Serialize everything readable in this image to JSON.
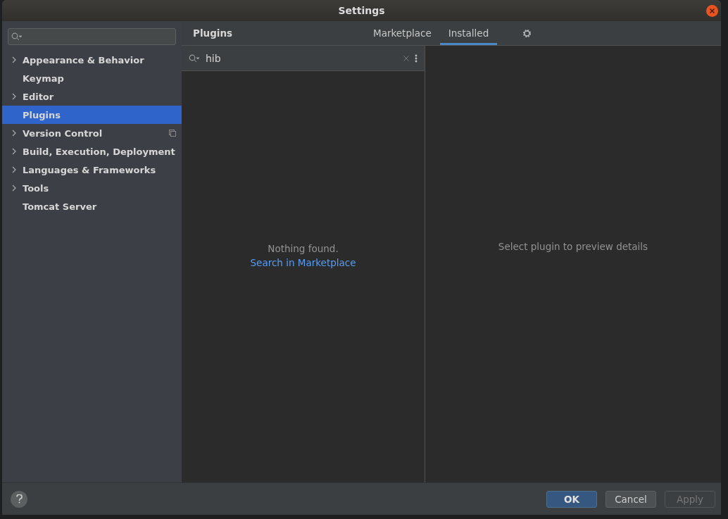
{
  "window": {
    "title": "Settings"
  },
  "sidebar": {
    "items": [
      {
        "label": "Appearance & Behavior",
        "expandable": true,
        "selected": false,
        "badge": false
      },
      {
        "label": "Keymap",
        "expandable": false,
        "selected": false,
        "badge": false
      },
      {
        "label": "Editor",
        "expandable": true,
        "selected": false,
        "badge": false
      },
      {
        "label": "Plugins",
        "expandable": false,
        "selected": true,
        "badge": false
      },
      {
        "label": "Version Control",
        "expandable": true,
        "selected": false,
        "badge": true
      },
      {
        "label": "Build, Execution, Deployment",
        "expandable": true,
        "selected": false,
        "badge": false
      },
      {
        "label": "Languages & Frameworks",
        "expandable": true,
        "selected": false,
        "badge": false
      },
      {
        "label": "Tools",
        "expandable": true,
        "selected": false,
        "badge": false
      },
      {
        "label": "Tomcat Server",
        "expandable": false,
        "selected": false,
        "badge": false
      }
    ]
  },
  "header": {
    "title": "Plugins",
    "tabs": [
      {
        "label": "Marketplace",
        "selected": false
      },
      {
        "label": "Installed",
        "selected": true
      }
    ]
  },
  "plugin_search": {
    "value": "hib"
  },
  "results": {
    "message": "Nothing found.",
    "link": "Search in Marketplace"
  },
  "details": {
    "message": "Select plugin to preview details"
  },
  "buttons": [
    {
      "label": "OK",
      "kind": "primary"
    },
    {
      "label": "Cancel",
      "kind": "normal"
    },
    {
      "label": "Apply",
      "kind": "disabled"
    }
  ]
}
